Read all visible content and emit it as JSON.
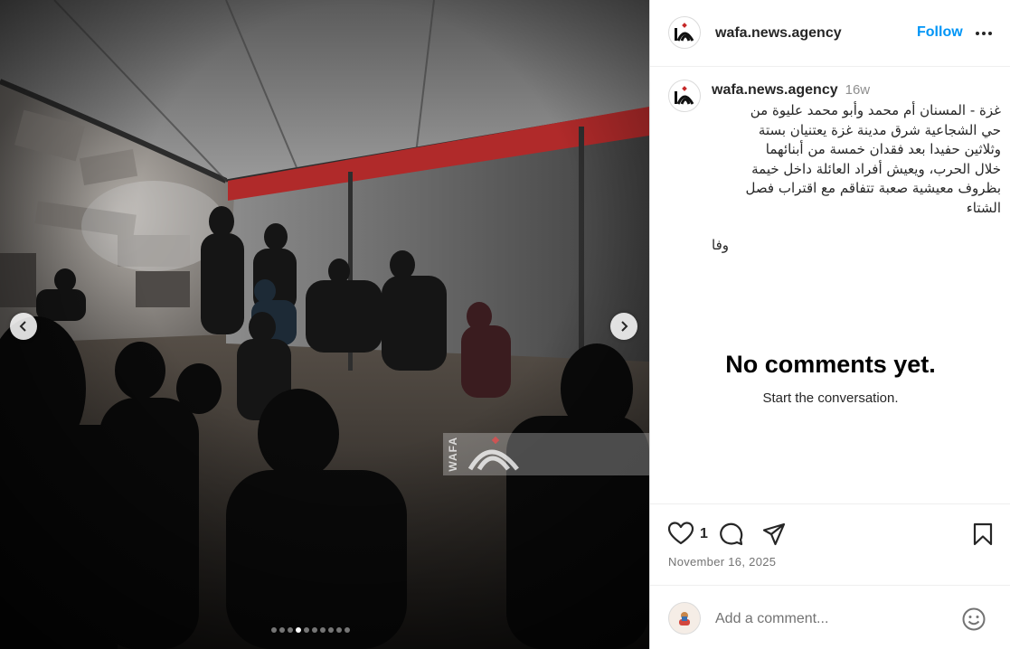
{
  "post": {
    "username": "wafa.news.agency",
    "follow_label": "Follow",
    "caption_time": "16w",
    "caption_lines": [
      "غزة - المسنان أم محمد وأبو محمد عليوة من",
      "حي الشجاعية شرق مدينة غزة يعتنيان بستة",
      "وثلاثين حفيدا بعد فقدان خمسة من أبنائهما",
      "خلال الحرب، ويعيش أفراد العائلة داخل خيمة",
      "بظروف معيشية صعبة تتفاقم مع اقتراب فصل",
      "الشتاء"
    ],
    "caption_signature": "وفا",
    "likes": "1",
    "date": "November 16, 2025"
  },
  "comments": {
    "empty_title": "No comments yet.",
    "empty_subtitle": "Start the conversation.",
    "input_placeholder": "Add a comment..."
  },
  "media": {
    "watermark": "WAFA",
    "carousel_count": 10,
    "carousel_active": 3
  },
  "icons": {
    "more": "more-options-icon",
    "like": "heart-icon",
    "comment": "comment-icon",
    "share": "share-icon",
    "save": "bookmark-icon",
    "emoji": "emoji-icon",
    "prev": "chevron-left-icon",
    "next": "chevron-right-icon"
  },
  "colors": {
    "accent": "#0095f6",
    "tent_stripe": "#b02a2a",
    "text": "#262626",
    "muted": "#737373"
  }
}
